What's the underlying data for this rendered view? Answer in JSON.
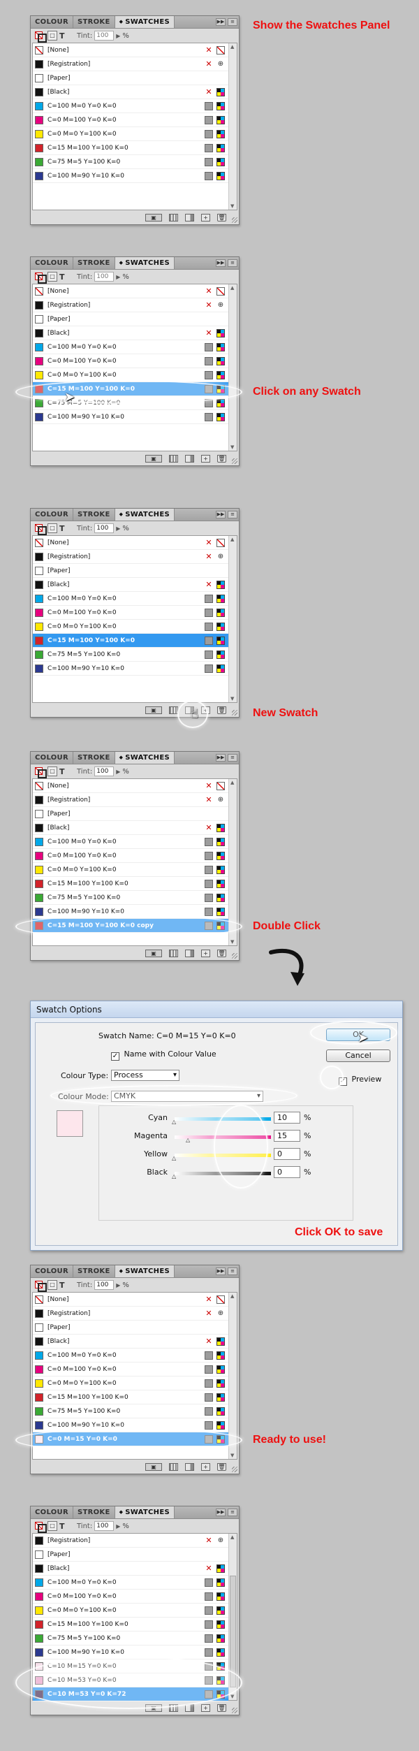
{
  "panel_tabs": [
    "COLOUR",
    "STROKE",
    "SWATCHES"
  ],
  "tint": {
    "label": "Tint:",
    "value": "100",
    "pct": "%"
  },
  "captions": {
    "p1": "Show the Swatches Panel",
    "p2": "Click on any Swatch",
    "p3": "New Swatch",
    "p4": "Double Click",
    "p5": "Click OK to save",
    "p6": "Ready to use!"
  },
  "swatches": {
    "none": "[None]",
    "registration": "[Registration]",
    "paper": "[Paper]",
    "black": "[Black]",
    "cyan": "C=100 M=0 Y=0 K=0",
    "magenta": "C=0 M=100 Y=0 K=0",
    "yellow": "C=0 M=0 Y=100 K=0",
    "red": "C=15 M=100 Y=100 K=0",
    "green": "C=75 M=5 Y=100 K=0",
    "blue": "C=100 M=90 Y=10 K=0",
    "red_copy": "C=15 M=100 Y=100 K=0 copy",
    "pink": "C=0 M=15 Y=0 K=0",
    "pink2": "C=10 M=15 Y=0 K=0",
    "pink3": "C=10 M=53 Y=0 K=0",
    "violet": "C=10 M=53 Y=0 K=72"
  },
  "colors": {
    "cyan": "#00a8e8",
    "magenta": "#e6007e",
    "yellow": "#ffe800",
    "red": "#d2232a",
    "green": "#3aa935",
    "blue": "#2b3990",
    "black": "#111111",
    "pink": "#fde6ec",
    "pink2": "#f5dde8",
    "pink3": "#e8a3c9",
    "violet": "#4a2f55",
    "selection": "#3399f0",
    "caption": "#ee1010"
  },
  "dialog": {
    "title": "Swatch Options",
    "swatch_name_label": "Swatch Name:",
    "swatch_name_value": "C=0 M=15 Y=0 K=0",
    "name_with_value": "Name with Colour Value",
    "colour_type_label": "Colour Type:",
    "colour_type_value": "Process",
    "colour_mode_label": "Colour Mode:",
    "colour_mode_value": "CMYK",
    "ok": "OK",
    "cancel": "Cancel",
    "preview": "Preview",
    "channels": [
      {
        "label": "Cyan",
        "value": "10",
        "color": "#00a8e8"
      },
      {
        "label": "Magenta",
        "value": "15",
        "color": "#e6007e"
      },
      {
        "label": "Yellow",
        "value": "0",
        "color": "#ffe800"
      },
      {
        "label": "Black",
        "value": "0",
        "color": "#111111"
      }
    ],
    "pct": "%"
  }
}
